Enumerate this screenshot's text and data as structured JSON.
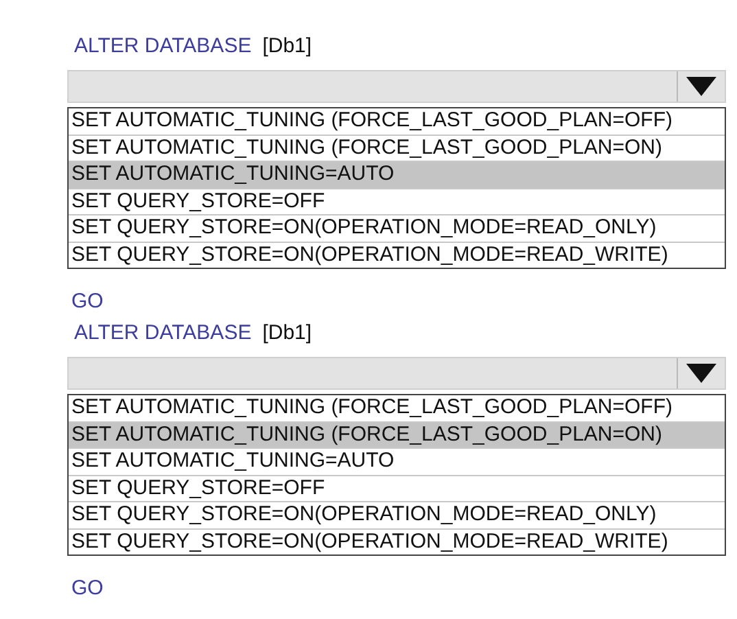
{
  "blocks": [
    {
      "keyword": "ALTER DATABASE",
      "target": "[Db1]",
      "options": [
        {
          "label": "SET AUTOMATIC_TUNING (FORCE_LAST_GOOD_PLAN=OFF)",
          "selected": false
        },
        {
          "label": "SET AUTOMATIC_TUNING (FORCE_LAST_GOOD_PLAN=ON)",
          "selected": false
        },
        {
          "label": "SET AUTOMATIC_TUNING=AUTO",
          "selected": true
        },
        {
          "label": "SET QUERY_STORE=OFF",
          "selected": false
        },
        {
          "label": "SET QUERY_STORE=ON(OPERATION_MODE=READ_ONLY)",
          "selected": false
        },
        {
          "label": "SET QUERY_STORE=ON(OPERATION_MODE=READ_WRITE)",
          "selected": false
        }
      ],
      "go": "GO"
    },
    {
      "keyword": "ALTER DATABASE",
      "target": "[Db1]",
      "options": [
        {
          "label": "SET AUTOMATIC_TUNING (FORCE_LAST_GOOD_PLAN=OFF)",
          "selected": false
        },
        {
          "label": "SET AUTOMATIC_TUNING (FORCE_LAST_GOOD_PLAN=ON)",
          "selected": true
        },
        {
          "label": "SET AUTOMATIC_TUNING=AUTO",
          "selected": false
        },
        {
          "label": "SET QUERY_STORE=OFF",
          "selected": false
        },
        {
          "label": "SET QUERY_STORE=ON(OPERATION_MODE=READ_ONLY)",
          "selected": false
        },
        {
          "label": "SET QUERY_STORE=ON(OPERATION_MODE=READ_WRITE)",
          "selected": false
        }
      ],
      "go": "GO"
    }
  ]
}
